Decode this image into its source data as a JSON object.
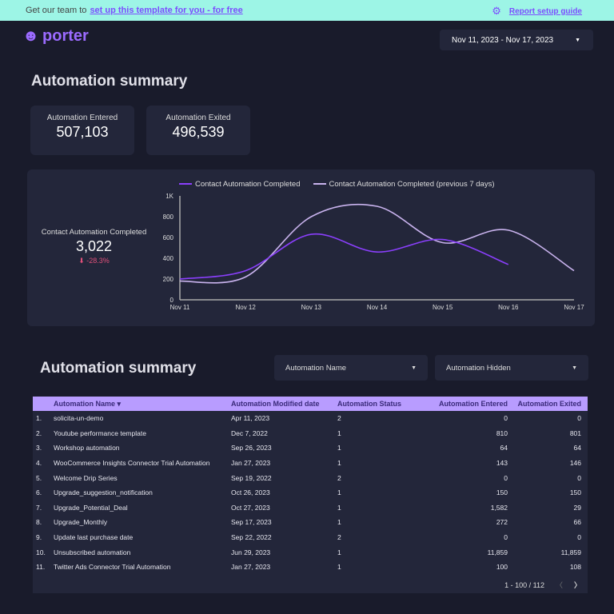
{
  "banner": {
    "text": "Get our team to",
    "link": "set up this template for you - for free",
    "guide": "Report setup guide"
  },
  "brand": {
    "name": "porter",
    "accent": "#9b6bff"
  },
  "date_range": "Nov 11, 2023 - Nov 17, 2023",
  "section1_title": "Automation summary",
  "kpis": [
    {
      "label": "Automation Entered",
      "value": "507,103"
    },
    {
      "label": "Automation Exited",
      "value": "496,539"
    }
  ],
  "scorecard": {
    "label": "Contact Automation Completed",
    "value": "3,022",
    "delta": "-28.3%"
  },
  "chart_data": {
    "type": "line",
    "categories": [
      "Nov 11",
      "Nov 12",
      "Nov 13",
      "Nov 14",
      "Nov 15",
      "Nov 16",
      "Nov 17"
    ],
    "y_ticks": [
      "0",
      "200",
      "400",
      "600",
      "800",
      "1K"
    ],
    "ylim": [
      0,
      1000
    ],
    "legend": "top",
    "series": [
      {
        "name": "Contact Automation Completed",
        "color": "#8a3ffc",
        "values": [
          200,
          280,
          630,
          460,
          580,
          340,
          null
        ]
      },
      {
        "name": "Contact Automation Completed (previous 7 days)",
        "color": "#c9b3ee",
        "values": [
          180,
          220,
          800,
          900,
          550,
          670,
          280
        ]
      }
    ]
  },
  "section2_title": "Automation summary",
  "filters": [
    "Automation Name",
    "Automation Hidden"
  ],
  "table": {
    "headers": [
      "Automation Name ▾",
      "Automation Modified date",
      "Automation Status",
      "Automation Entered",
      "Automation Exited"
    ],
    "rows": [
      [
        "1.",
        "solicita-un-demo",
        "Apr 11, 2023",
        "2",
        "0",
        "0"
      ],
      [
        "2.",
        "Youtube performance template",
        "Dec 7, 2022",
        "1",
        "810",
        "801"
      ],
      [
        "3.",
        "Workshop automation",
        "Sep 26, 2023",
        "1",
        "64",
        "64"
      ],
      [
        "4.",
        "WooCommerce Insights Connector Trial Automation",
        "Jan 27, 2023",
        "1",
        "143",
        "146"
      ],
      [
        "5.",
        "Welcome Drip Series",
        "Sep 19, 2022",
        "2",
        "0",
        "0"
      ],
      [
        "6.",
        "Upgrade_suggestion_notification",
        "Oct 26, 2023",
        "1",
        "150",
        "150"
      ],
      [
        "7.",
        "Upgrade_Potential_Deal",
        "Oct 27, 2023",
        "1",
        "1,582",
        "29"
      ],
      [
        "8.",
        "Upgrade_Monthly",
        "Sep 17, 2023",
        "1",
        "272",
        "66"
      ],
      [
        "9.",
        "Update last purchase date",
        "Sep 22, 2022",
        "2",
        "0",
        "0"
      ],
      [
        "10.",
        "Unsubscribed automation",
        "Jun 29, 2023",
        "1",
        "11,859",
        "11,859"
      ],
      [
        "11.",
        "Twitter Ads Connector Trial Automation",
        "Jan 27, 2023",
        "1",
        "100",
        "108"
      ]
    ],
    "pagination": "1 - 100 / 112"
  }
}
